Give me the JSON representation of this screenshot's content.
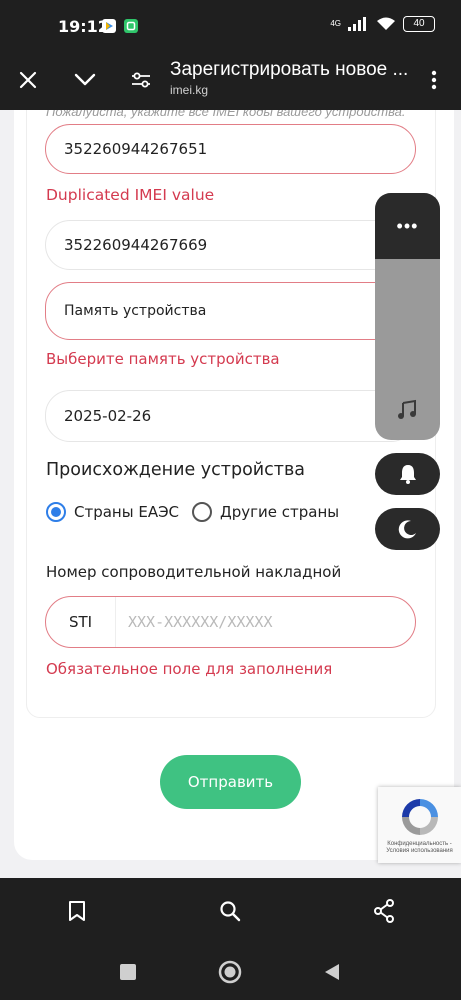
{
  "status_bar": {
    "time": "19:12",
    "network": "4G",
    "battery": "40"
  },
  "header": {
    "title": "Зарегистрировать новое ...",
    "domain": "imei.kg",
    "icons": [
      "close-icon",
      "chevron-down-icon",
      "tune-icon",
      "more-vert-icon"
    ]
  },
  "form": {
    "hint": "Пожалуйста, укажите все IMEI коды вашего устройства.",
    "imei1_value": "352260944267651",
    "imei1_error": "Duplicated IMEI value",
    "imei2_value": "352260944267669",
    "memory_select": "Память устройства",
    "memory_error": "Выберите память устройства",
    "date_value": "2025-02-26",
    "origin_title": "Происхождение устройства",
    "origin_options": [
      "Страны ЕАЭС",
      "Другие страны"
    ],
    "origin_selected": "Страны ЕАЭС",
    "waybill_label": "Номер сопроводительной накладной",
    "waybill_prefix": "STI",
    "waybill_placeholder": "XXX-XXXXXX/XXXXX",
    "waybill_error": "Обязательное поле для заполнения",
    "submit_label": "Отправить"
  },
  "recaptcha": {
    "text": "Конфиденциальность - Условия использования"
  },
  "colors": {
    "error": "#d43a4f",
    "accent_green": "#3fc282",
    "radio_blue": "#2e7ee8",
    "dark_bar": "#1f1f1f"
  }
}
